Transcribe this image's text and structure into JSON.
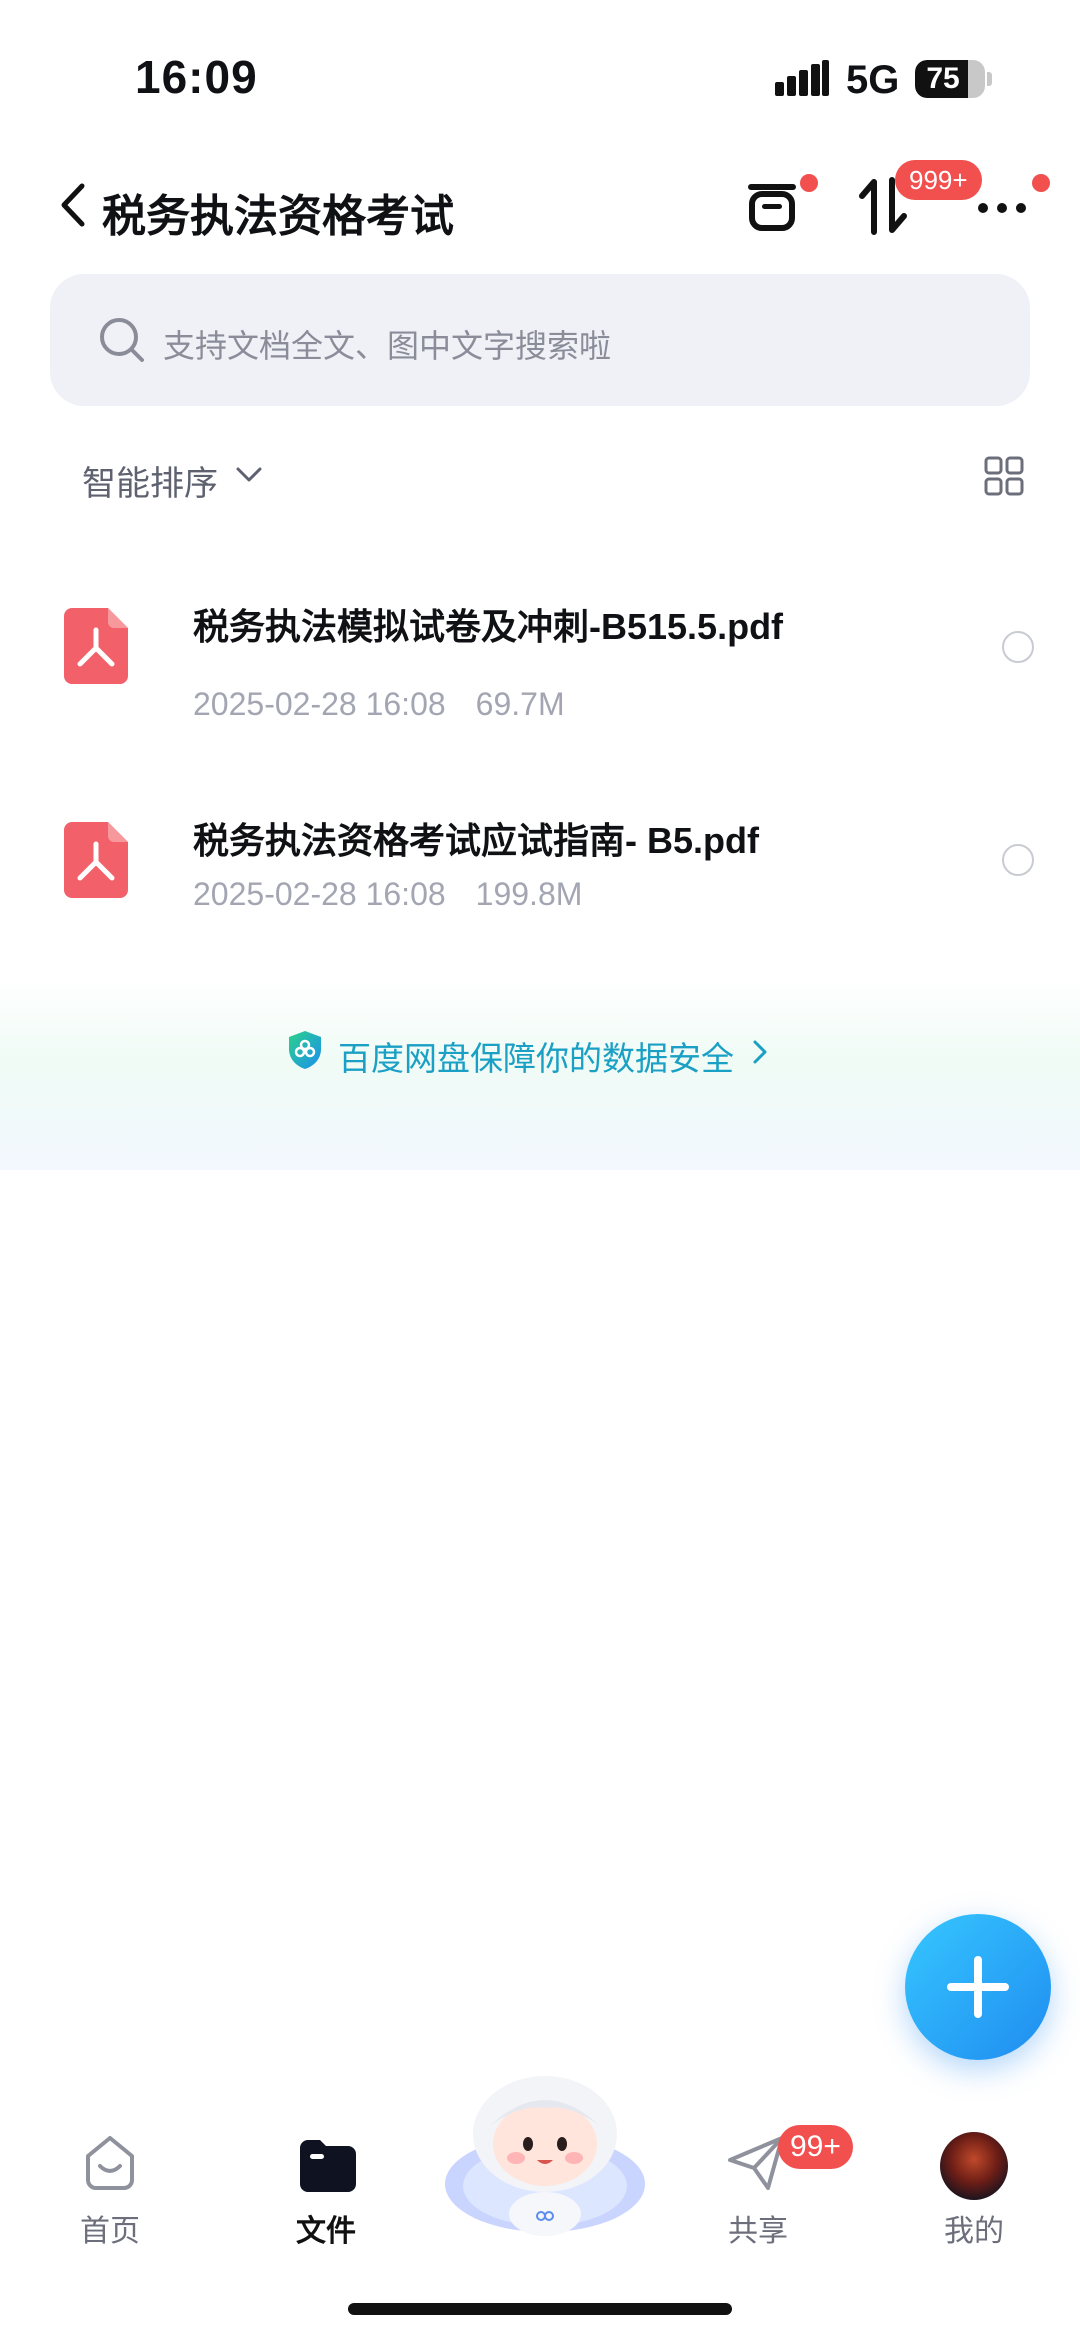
{
  "status_bar": {
    "time": "16:09",
    "network": "5G",
    "battery": "75",
    "battery_level_percent": 75
  },
  "header": {
    "title": "税务执法资格考试",
    "transfer_badge": "999+",
    "icons": [
      "back-arrow-icon",
      "archive-box-icon",
      "transfer-arrows-icon",
      "more-icon"
    ]
  },
  "search": {
    "placeholder": "支持文档全文、图中文字搜索啦"
  },
  "sort": {
    "label": "智能排序"
  },
  "files": [
    {
      "name": "税务执法模拟试卷及冲刺-B515.5.pdf",
      "date": "2025-02-28 16:08",
      "size": "69.7M",
      "icon": "pdf-icon"
    },
    {
      "name": "税务执法资格考试应试指南- B5.pdf",
      "date": "2025-02-28 16:08",
      "size": "199.8M",
      "icon": "pdf-icon"
    }
  ],
  "banner": {
    "text": "百度网盘保障你的数据安全"
  },
  "nav": {
    "home": "首页",
    "files": "文件",
    "share": "共享",
    "share_badge": "99+",
    "mine": "我的"
  },
  "colors": {
    "accent": "#1f8cf0",
    "badge": "#f1504f",
    "pdf": "#f2616a",
    "banner_text": "#1aa0c4"
  }
}
